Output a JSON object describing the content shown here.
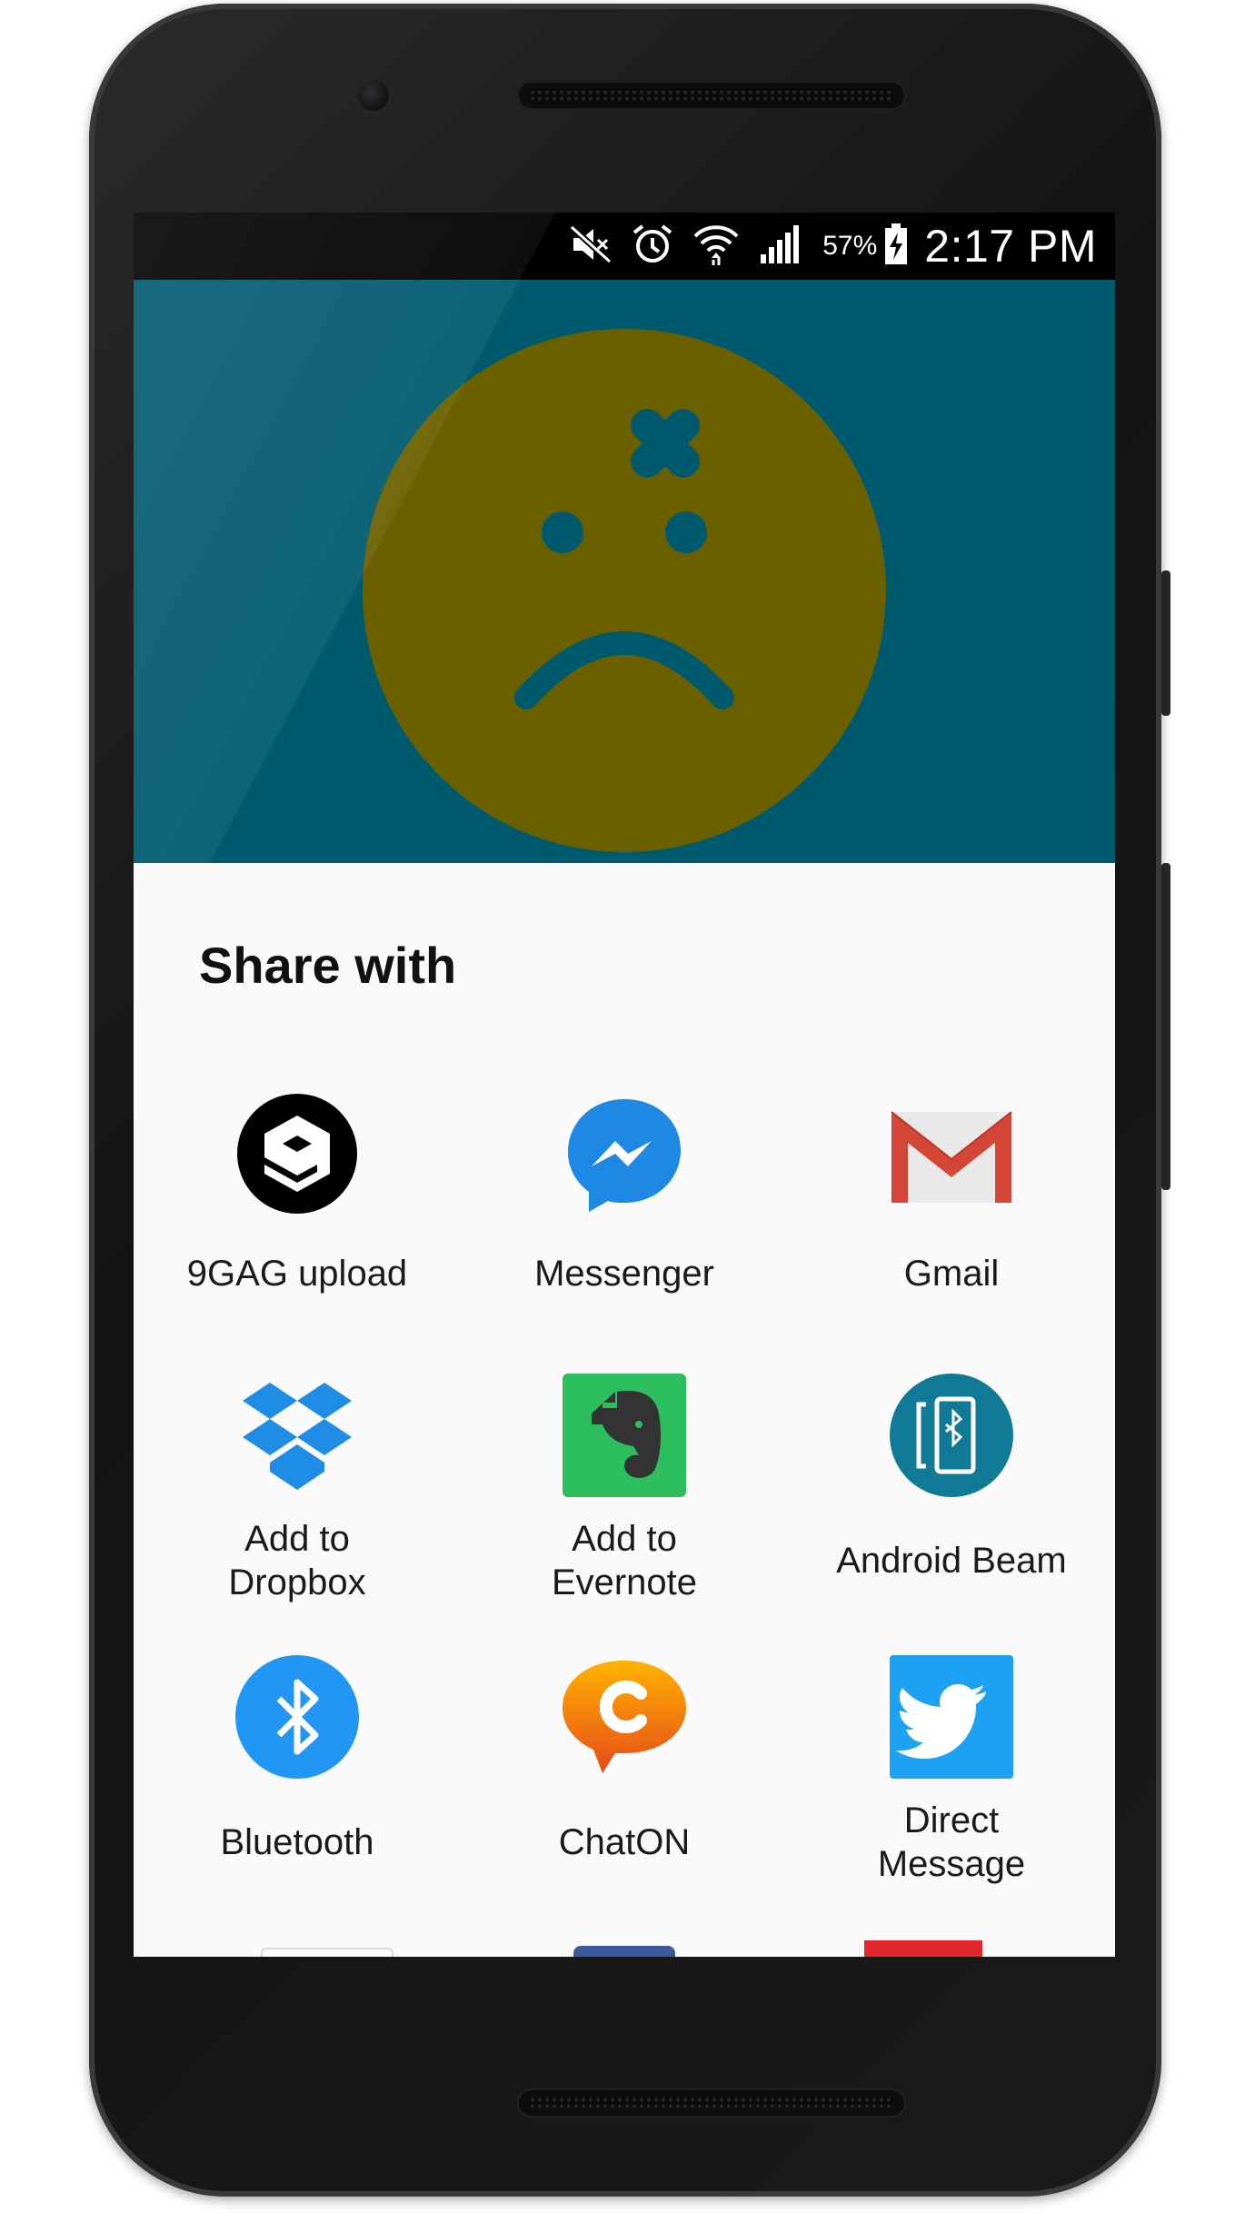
{
  "status_bar": {
    "icons": [
      "mute-icon",
      "alarm-icon",
      "wifi-icon",
      "signal-icon",
      "battery-charging-icon"
    ],
    "battery_percent": "57%",
    "time": "2:17 PM"
  },
  "app": {
    "background_color": "#005a6e",
    "face_color": "#6b6000",
    "illustration": "sad-face-with-bandage-icon"
  },
  "share_sheet": {
    "title": "Share with",
    "targets": [
      {
        "label": "9GAG upload",
        "icon": "9gag-icon"
      },
      {
        "label": "Messenger",
        "icon": "messenger-icon"
      },
      {
        "label": "Gmail",
        "icon": "gmail-icon"
      },
      {
        "label": "Add to\nDropbox",
        "icon": "dropbox-icon"
      },
      {
        "label": "Add to\nEvernote",
        "icon": "evernote-icon"
      },
      {
        "label": "Android Beam",
        "icon": "android-beam-icon"
      },
      {
        "label": "Bluetooth",
        "icon": "bluetooth-icon"
      },
      {
        "label": "ChatON",
        "icon": "chaton-icon"
      },
      {
        "label": "Direct\nMessage",
        "icon": "twitter-icon"
      }
    ],
    "partial_row_icons": [
      "partial-app-icon",
      "facebook-icon",
      "red-app-icon"
    ]
  },
  "colors": {
    "messenger": "#1e88e5",
    "gmail_red": "#d44638",
    "dropbox": "#1f8ce6",
    "evernote": "#2dbe60",
    "android_beam": "#117a96",
    "bluetooth": "#2196f3",
    "chaton": "#f57c00",
    "twitter": "#1da1f2"
  }
}
